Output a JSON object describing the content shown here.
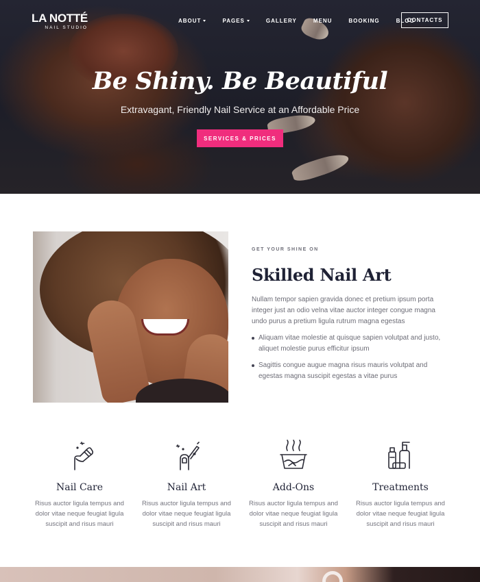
{
  "brand": {
    "name": "LA NOTTÉ",
    "tagline": "NAIL STUDIO"
  },
  "nav": {
    "items": [
      {
        "label": "ABOUT",
        "has_dropdown": true
      },
      {
        "label": "PAGES",
        "has_dropdown": true
      },
      {
        "label": "GALLERY",
        "has_dropdown": false
      },
      {
        "label": "MENU",
        "has_dropdown": false
      },
      {
        "label": "BOOKING",
        "has_dropdown": false
      },
      {
        "label": "BLOG",
        "has_dropdown": false
      }
    ],
    "cta": "CONTACTS"
  },
  "hero": {
    "title": "Be Shiny. Be Beautiful",
    "subtitle": "Extravagant, Friendly Nail Service at an Affordable Price",
    "button": "SERVICES & PRICES"
  },
  "about": {
    "eyebrow": "GET YOUR SHINE ON",
    "title": "Skilled Nail Art",
    "text": "Nullam tempor sapien gravida donec et pretium ipsum porta integer just an odio velna vitae auctor integer congue magna undo purus a pretium ligula rutrum magna egestas",
    "bullets": [
      "Aliquam vitae molestie at quisque sapien volutpat and justo, aliquet molestie purus efficitur ipsum",
      "Sagittis congue augue magna risus mauris volutpat and egestas magna suscipit egestas a vitae purus"
    ]
  },
  "services": [
    {
      "icon": "nail-file-icon",
      "title": "Nail Care",
      "text": "Risus auctor ligula tempus and dolor vitae neque feugiat ligula suscipit and risus mauri"
    },
    {
      "icon": "nail-polish-brush-icon",
      "title": "Nail Art",
      "text": "Risus auctor ligula tempus and dolor vitae neque feugiat ligula suscipit and risus mauri"
    },
    {
      "icon": "nail-soak-bowl-icon",
      "title": "Add-Ons",
      "text": "Risus auctor ligula tempus and dolor vitae neque feugiat ligula suscipit and risus mauri"
    },
    {
      "icon": "cosmetic-bottles-icon",
      "title": "Treatments",
      "text": "Risus auctor ligula tempus and dolor vitae neque feugiat ligula suscipit and risus mauri"
    }
  ],
  "colors": {
    "accent": "#f02d7d",
    "heading": "#1f2235",
    "body_text": "#6c6c76",
    "hero_bg": "#1e1f29"
  }
}
